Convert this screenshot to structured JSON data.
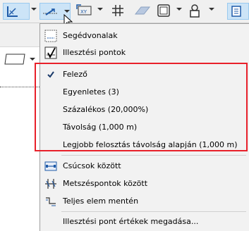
{
  "toolbar": {
    "buttons": [
      {
        "name": "guide-lines-tool-icon"
      },
      {
        "name": "snap-point-tool-icon"
      },
      {
        "name": "xy-coordinate-icon"
      },
      {
        "name": "grid-snap-icon"
      },
      {
        "name": "plane-icon"
      },
      {
        "name": "layout-frame-icon"
      },
      {
        "name": "user-lock-icon"
      },
      {
        "name": "settings-icon"
      }
    ]
  },
  "menu": {
    "guides_label": "Segédvonalak",
    "snap_points_label": "Illesztési pontok",
    "midpoint_label": "Felező",
    "equal_label": "Egyenletes (3)",
    "percent_label": "Százalékos (20,000%)",
    "distance_label": "Távolság (1,000 m)",
    "best_division_label": "Legjobb felosztás távolság alapján (1,000 m)",
    "between_vertices_label": "Csúcsok között",
    "between_intersections_label": "Metszéspontok között",
    "whole_element_label": "Teljes elem mentén",
    "snap_values_label": "Illesztési pont értékek megadása..."
  },
  "colors": {
    "highlight_border": "#e8202a",
    "accent_blue": "#1e5aa8",
    "selected_button_bg": "#cce4f7"
  }
}
